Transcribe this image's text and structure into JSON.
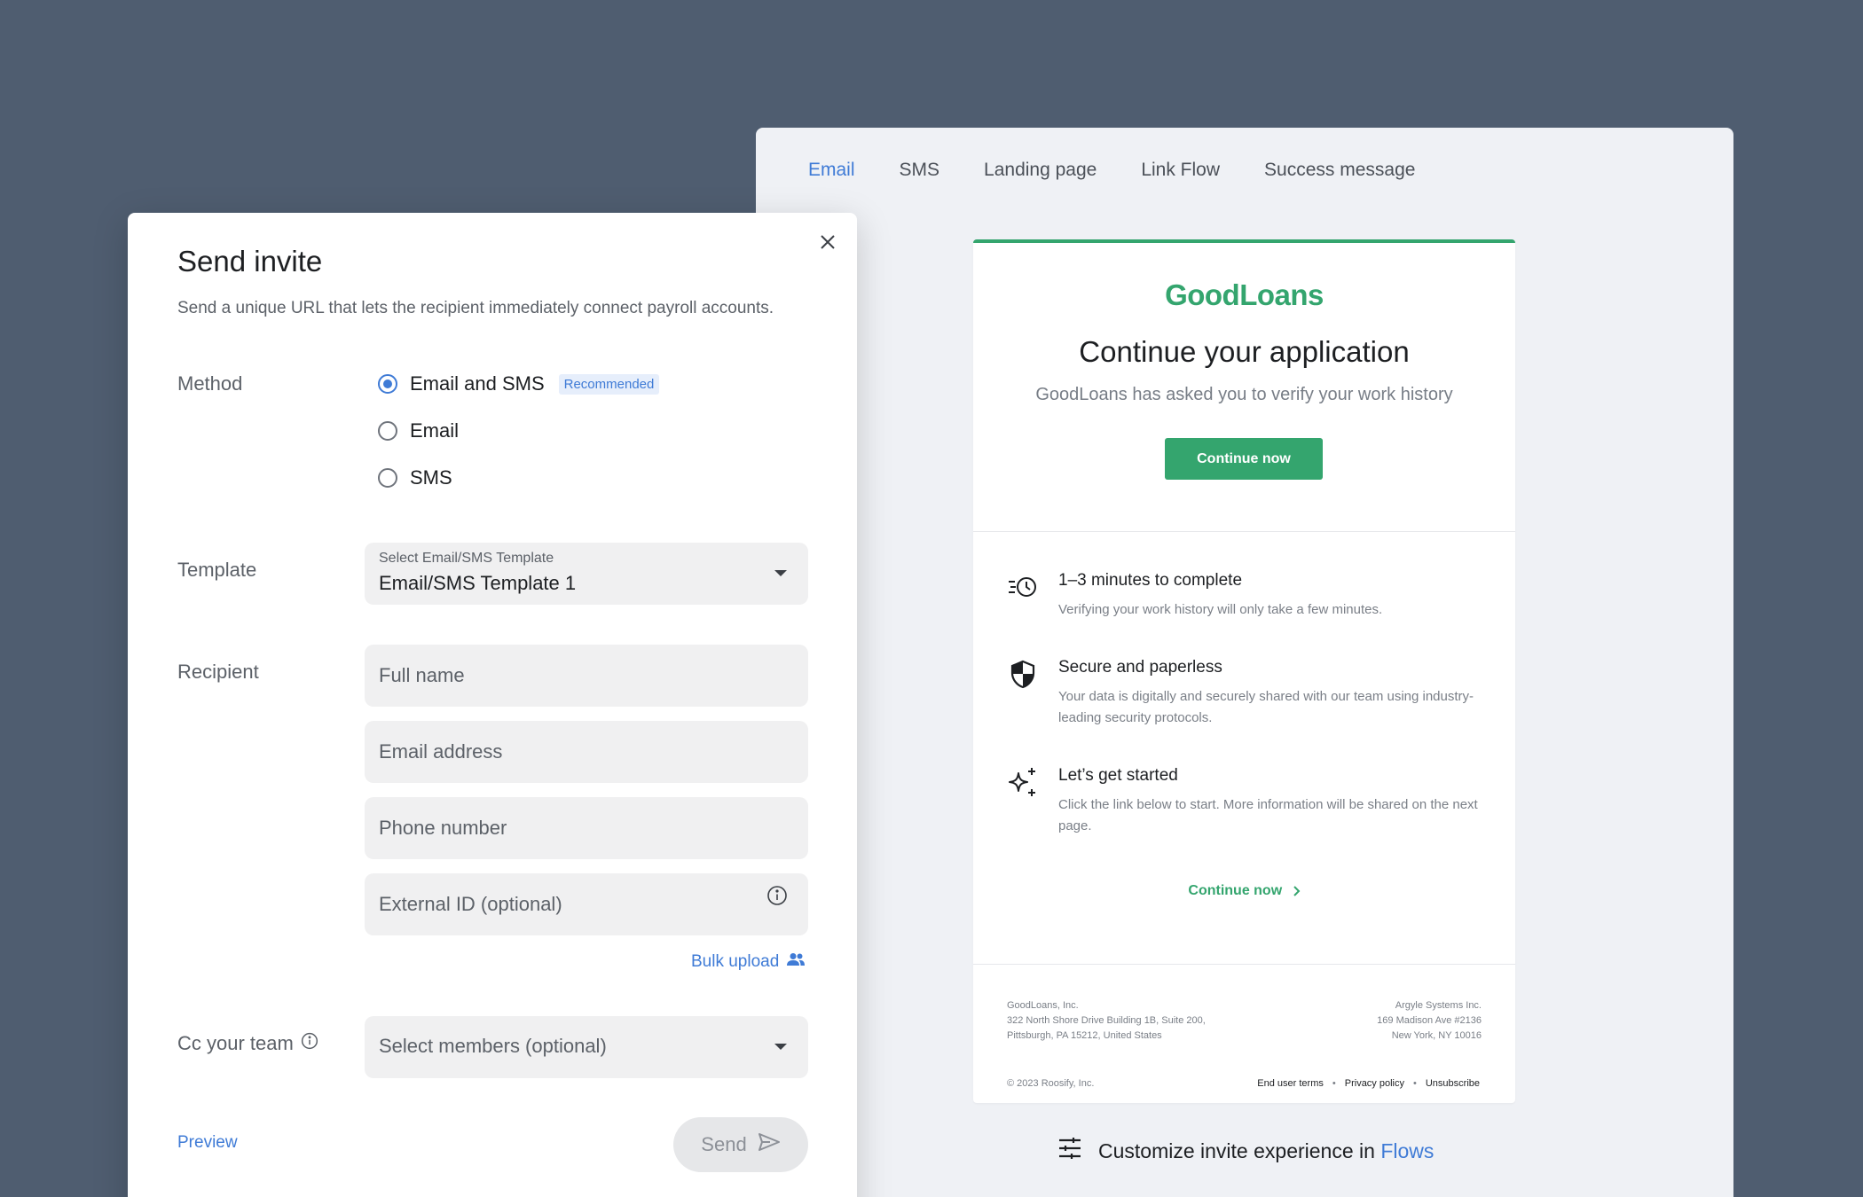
{
  "preview": {
    "tabs": [
      {
        "label": "Email",
        "active": true
      },
      {
        "label": "SMS",
        "active": false
      },
      {
        "label": "Landing page",
        "active": false
      },
      {
        "label": "Link Flow",
        "active": false
      },
      {
        "label": "Success message",
        "active": false
      }
    ],
    "email": {
      "brand": "GoodLoans",
      "heading": "Continue your application",
      "subheading": "GoodLoans has asked you to verify your work history",
      "cta_label": "Continue now",
      "features": [
        {
          "icon": "clock-speed-icon",
          "title": "1–3 minutes to complete",
          "description": "Verifying your work history will only take a few minutes."
        },
        {
          "icon": "shield-icon",
          "title": "Secure and paperless",
          "description": "Your data is digitally and securely shared with our team using industry-leading security protocols."
        },
        {
          "icon": "sparkle-icon",
          "title": "Let’s get started",
          "description": "Click the link below to start. More information will be shared on the next page."
        }
      ],
      "link_label": "Continue now",
      "footer_left": [
        "GoodLoans, Inc.",
        "322 North Shore Drive Building 1B, Suite 200,",
        "Pittsburgh, PA 15212, United States"
      ],
      "footer_right": [
        "Argyle Systems Inc.",
        "169 Madison Ave #2136",
        "New York, NY 10016"
      ],
      "copyright": "© 2023 Roosify, Inc.",
      "footer_links": [
        "End user terms",
        "Privacy policy",
        "Unsubscribe"
      ]
    },
    "customize_text": "Customize invite experience in",
    "customize_link": "Flows"
  },
  "modal": {
    "title": "Send invite",
    "description": "Send a unique URL that lets the recipient immediately connect payroll accounts.",
    "method_label": "Method",
    "methods": [
      {
        "label": "Email and SMS",
        "badge": "Recommended",
        "selected": true
      },
      {
        "label": "Email",
        "selected": false
      },
      {
        "label": "SMS",
        "selected": false
      }
    ],
    "template_label": "Template",
    "template_select_label": "Select Email/SMS Template",
    "template_value": "Email/SMS Template 1",
    "recipient_label": "Recipient",
    "inputs": {
      "full_name": "Full name",
      "email": "Email address",
      "phone": "Phone number",
      "external_id": "External ID (optional)"
    },
    "bulk_upload_label": "Bulk upload",
    "cc_label": "Cc your team",
    "cc_placeholder": "Select members (optional)",
    "preview_label": "Preview",
    "send_label": "Send"
  },
  "colors": {
    "background": "#4f5d70",
    "accent_blue": "#3f7bd6",
    "brand_green": "#34a56e"
  }
}
